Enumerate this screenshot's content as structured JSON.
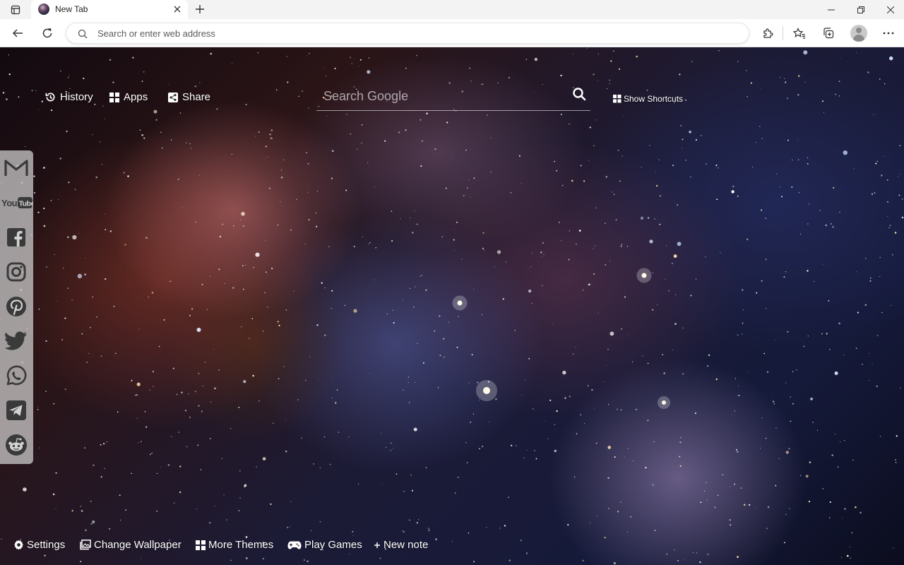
{
  "browser": {
    "tab": {
      "title": "New Tab"
    },
    "omnibox": {
      "placeholder": "Search or enter web address"
    }
  },
  "page": {
    "nav_links": [
      {
        "label": "History",
        "icon": "history-icon"
      },
      {
        "label": "Apps",
        "icon": "apps-grid-icon"
      },
      {
        "label": "Share",
        "icon": "share-icon"
      }
    ],
    "search": {
      "placeholder": "Search Google"
    },
    "shortcuts_label": "Show Shortcuts",
    "social_sidebar": [
      {
        "name": "gmail",
        "icon": "gmail-icon"
      },
      {
        "name": "youtube",
        "icon": "youtube-icon",
        "text": "YouTube"
      },
      {
        "name": "facebook",
        "icon": "facebook-icon"
      },
      {
        "name": "instagram",
        "icon": "instagram-icon"
      },
      {
        "name": "pinterest",
        "icon": "pinterest-icon"
      },
      {
        "name": "twitter",
        "icon": "twitter-icon"
      },
      {
        "name": "whatsapp",
        "icon": "whatsapp-icon"
      },
      {
        "name": "telegram",
        "icon": "telegram-icon"
      },
      {
        "name": "reddit",
        "icon": "reddit-icon"
      }
    ],
    "bottom_links": [
      {
        "label": "Settings",
        "icon": "gear-icon"
      },
      {
        "label": "Change Wallpaper",
        "icon": "wallpaper-icon"
      },
      {
        "label": "More Themes",
        "icon": "themes-grid-icon"
      },
      {
        "label": "Play Games",
        "icon": "gamepad-icon"
      },
      {
        "label": "New note",
        "icon": "plus-icon"
      }
    ]
  },
  "colors": {
    "text_on_wallpaper": "#ffffff",
    "sidebar_bg": "#d2d2d2",
    "sidebar_icon": "#3a3a3a"
  }
}
